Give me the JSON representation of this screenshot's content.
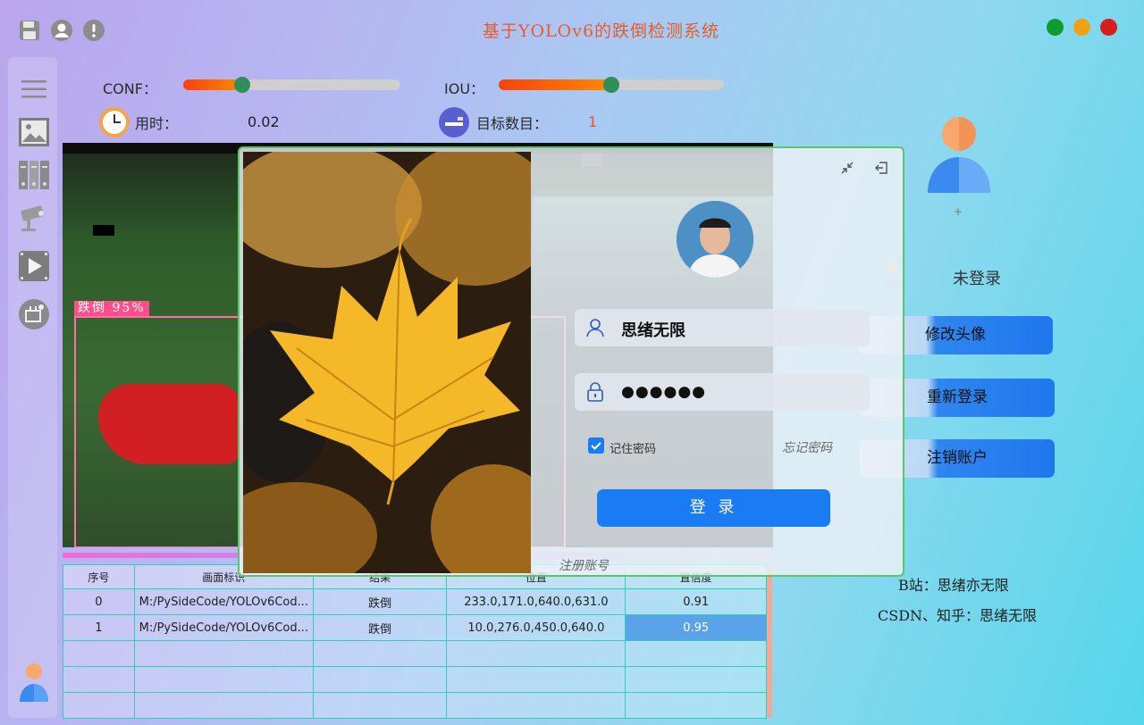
{
  "window": {
    "title": "基于YOLOv6的跌倒检测系统",
    "controls": {
      "close_color": "#d81d1d",
      "minimize_color": "#f2a112",
      "maximize_color": "#0f9a2e"
    }
  },
  "top_icons": [
    "save-icon",
    "user-icon",
    "alert-icon"
  ],
  "sidebar": {
    "items": [
      "menu-icon",
      "image-icon",
      "folder-icon",
      "camera-icon",
      "video-icon",
      "model-icon"
    ],
    "bottom": "user-avatar-icon"
  },
  "params": {
    "conf_label": "CONF：",
    "conf_value": 0.27,
    "iou_label": "IOU：",
    "iou_value": 0.5,
    "time_label": "用时：",
    "time_value": "0.02",
    "count_label": "目标数目：",
    "count_value": "1",
    "count_color": "#e8541c"
  },
  "detection": {
    "label": "跌倒 95%"
  },
  "table": {
    "headers": [
      "序号",
      "画面标识",
      "结果",
      "位置",
      "置信度"
    ],
    "rows": [
      [
        "0",
        "M:/PySideCode/YOLOv6Cod...",
        "跌倒",
        "233.0,171.0,640.0,631.0",
        "0.91"
      ],
      [
        "1",
        "M:/PySideCode/YOLOv6Cod...",
        "跌倒",
        "10.0,276.0,450.0,640.0",
        "0.95"
      ],
      [
        "",
        "",
        "",
        "",
        ""
      ],
      [
        "",
        "",
        "",
        "",
        ""
      ],
      [
        "",
        "",
        "",
        "",
        ""
      ]
    ]
  },
  "right_panel": {
    "status": "未登录",
    "plus": "+",
    "buttons": [
      "修改头像",
      "重新登录",
      "注销账户"
    ],
    "bilibili": "B站：思绪亦无限",
    "csdn": "CSDN、知乎：思绪无限"
  },
  "login": {
    "username": "思绪无限",
    "password_mask": "●●●●●●",
    "remember_label": "记住密码",
    "remember_checked": true,
    "forgot_label": "忘记密码",
    "login_button": "登 录",
    "register_link": "注册账号"
  }
}
